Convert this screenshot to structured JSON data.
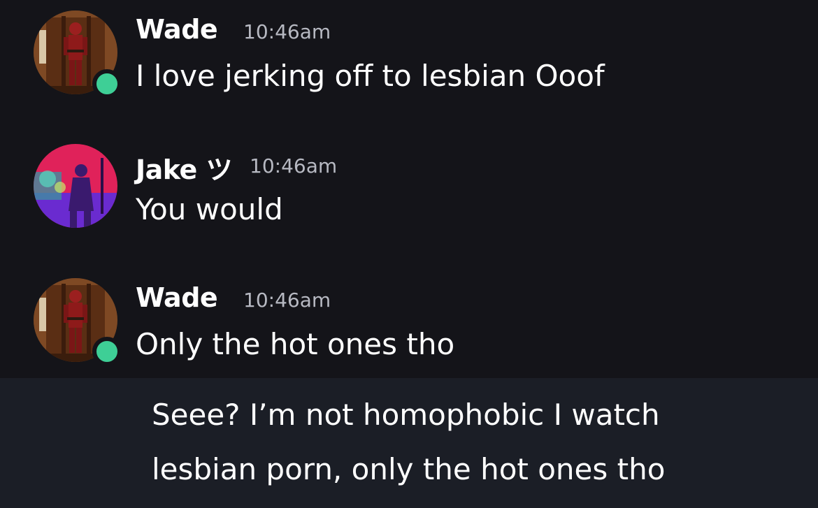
{
  "messages": [
    {
      "author": "Wade",
      "time": "10:46am",
      "text": "I love jerking off to lesbian Ooof",
      "avatar_icon": "deadpool-avatar",
      "online": true
    },
    {
      "author": "Jake ツ",
      "time": "10:46am",
      "text": "You would",
      "avatar_icon": "concert-avatar",
      "online": false
    },
    {
      "author": "Wade",
      "time": "10:46am",
      "text": "Only the hot ones tho",
      "avatar_icon": "deadpool-avatar",
      "online": true
    }
  ],
  "caption": {
    "line1": "Seee? I’m not homophobic I watch",
    "line2": "lesbian porn, only the hot ones tho"
  },
  "colors": {
    "background": "#141419",
    "caption_background": "#1b1e26",
    "online_indicator": "#3ecf96",
    "timestamp": "#b7b9c2"
  }
}
